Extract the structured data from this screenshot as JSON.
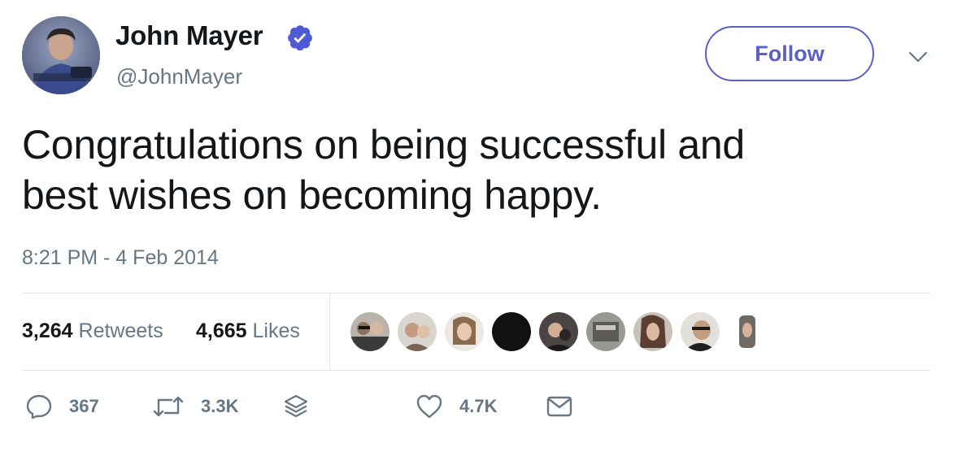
{
  "author": {
    "name": "John Mayer",
    "handle": "@JohnMayer",
    "verified": true
  },
  "follow_label": "Follow",
  "tweet": {
    "line1": "Congratulations on being successful and",
    "line2": "best wishes on becoming happy.",
    "timestamp": "8:21 PM - 4 Feb 2014"
  },
  "stats": {
    "retweets_count": "3,264",
    "retweets_label": "Retweets",
    "likes_count": "4,665",
    "likes_label": "Likes"
  },
  "actions": {
    "reply_count": "367",
    "retweet_count": "3.3K",
    "like_count": "4.7K"
  },
  "icons": {
    "verified": "verified-badge-icon",
    "caret": "chevron-down-icon",
    "reply": "reply-bubble-icon",
    "retweet": "retweet-icon",
    "stack": "layers-icon",
    "like": "heart-icon",
    "dm": "envelope-icon"
  },
  "colors": {
    "accent": "#5b5fc7",
    "verified": "#4f5bd5",
    "text": "#14171a",
    "secondary": "#657786",
    "divider": "#e1e8ed"
  },
  "liker_avatar_count": 9
}
